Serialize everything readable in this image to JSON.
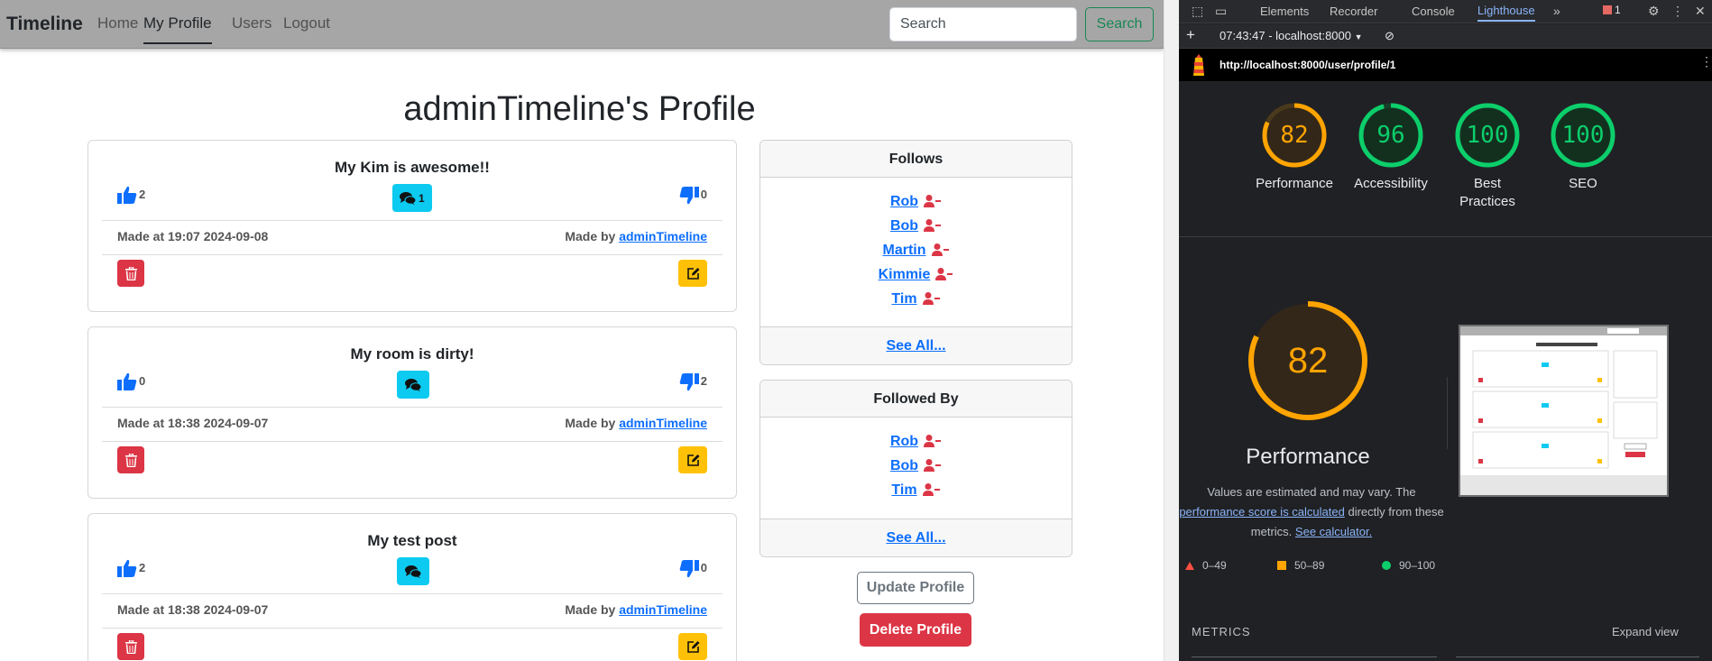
{
  "navbar": {
    "brand": "Timeline",
    "links": [
      "Home",
      "My Profile",
      "Users",
      "Logout"
    ],
    "search_placeholder": "Search",
    "search_button": "Search"
  },
  "profile": {
    "title": "adminTimeline's Profile"
  },
  "posts": [
    {
      "title": "My Kim is awesome!!",
      "likes": "2",
      "dislikes": "0",
      "comments": "1",
      "made_at": "Made at 19:07 2024-09-08",
      "made_by_prefix": "Made by",
      "author": "adminTimeline"
    },
    {
      "title": "My room is dirty!",
      "likes": "0",
      "dislikes": "2",
      "comments": "",
      "made_at": "Made at 18:38 2024-09-07",
      "made_by_prefix": "Made by",
      "author": "adminTimeline"
    },
    {
      "title": "My test post",
      "likes": "2",
      "dislikes": "0",
      "comments": "",
      "made_at": "Made at 18:38 2024-09-07",
      "made_by_prefix": "Made by",
      "author": "adminTimeline"
    }
  ],
  "follows": {
    "title": "Follows",
    "users": [
      "Rob",
      "Bob",
      "Martin",
      "Kimmie",
      "Tim"
    ],
    "see_all": "See All..."
  },
  "followed_by": {
    "title": "Followed By",
    "users": [
      "Rob",
      "Bob",
      "Tim"
    ],
    "see_all": "See All..."
  },
  "profile_actions": {
    "update": "Update Profile",
    "delete": "Delete Profile"
  },
  "devtools": {
    "tabs": [
      "Elements",
      "Recorder",
      "Console",
      "Lighthouse"
    ],
    "active_tab": "Lighthouse",
    "error_count": "1",
    "report_selector": "07:43:47 - localhost:8000",
    "url": "http://localhost:8000/user/profile/1",
    "scores": [
      {
        "label": "Performance",
        "value": 82,
        "color": "#ffa400"
      },
      {
        "label": "Accessibility",
        "value": 96,
        "color": "#0cce6b"
      },
      {
        "label": "Best Practices",
        "value": 100,
        "color": "#0cce6b"
      },
      {
        "label": "SEO",
        "value": 100,
        "color": "#0cce6b"
      }
    ],
    "performance": {
      "score": "82",
      "title": "Performance",
      "desc_1": "Values are estimated and may vary. The",
      "desc_link": "performance score is calculated",
      "desc_2": "directly from these metrics.",
      "calc_link": "See calculator."
    },
    "legend": [
      "0–49",
      "50–89",
      "90–100"
    ],
    "metrics_label": "METRICS",
    "expand_view": "Expand view"
  },
  "colors": {
    "like_blue": "#0d6efd",
    "comment_cyan": "#0dcaf0",
    "danger_red": "#dc3545",
    "warning_yellow": "#ffc107",
    "success_green": "#198754"
  }
}
